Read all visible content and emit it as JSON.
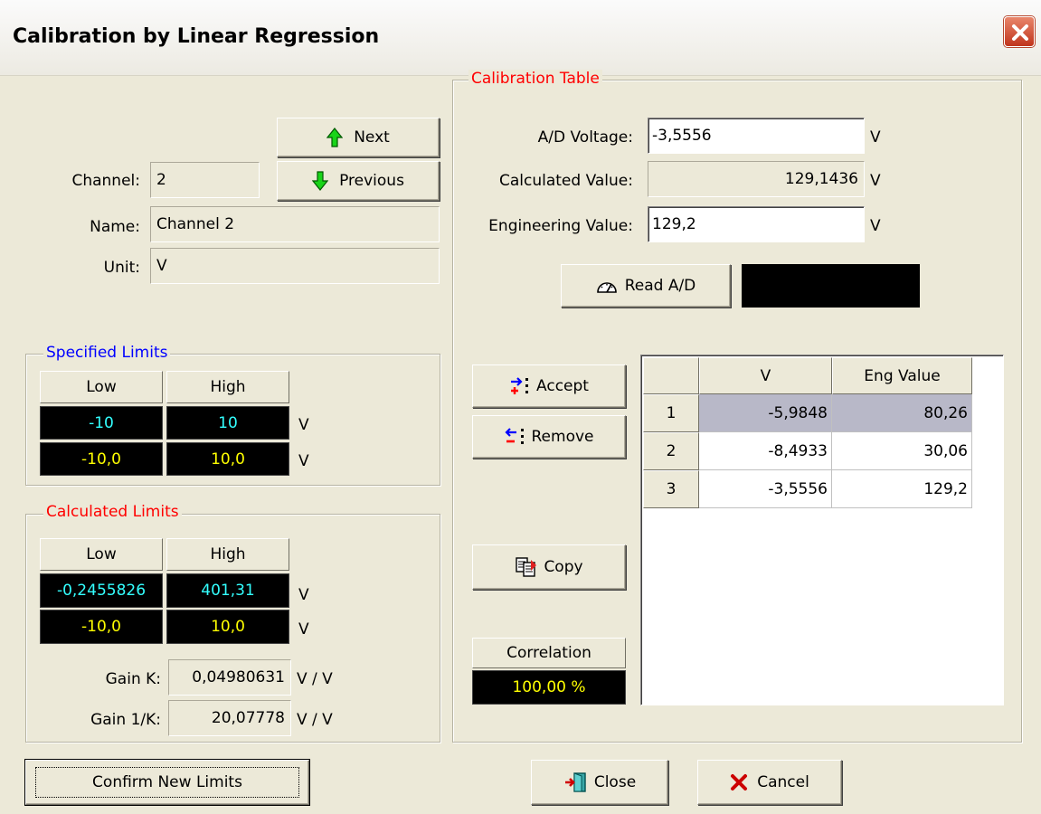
{
  "window": {
    "title": "Calibration by Linear Regression"
  },
  "channel": {
    "next_label": "Next",
    "previous_label": "Previous",
    "channel_label": "Channel:",
    "channel_value": "2",
    "name_label": "Name:",
    "name_value": "Channel 2",
    "unit_label": "Unit:",
    "unit_value": "V"
  },
  "specified_limits": {
    "title": "Specified Limits",
    "low_header": "Low",
    "high_header": "High",
    "row1": {
      "low": "-10",
      "high": "10",
      "unit": "V"
    },
    "row2": {
      "low": "-10,0",
      "high": "10,0",
      "unit": "V"
    }
  },
  "calculated_limits": {
    "title": "Calculated Limits",
    "low_header": "Low",
    "high_header": "High",
    "row1": {
      "low": "-0,2455826",
      "high": "401,31",
      "unit": "V"
    },
    "row2": {
      "low": "-10,0",
      "high": "10,0",
      "unit": "V"
    },
    "gain_k_label": "Gain K:",
    "gain_k_value": "0,04980631",
    "gain_k_unit": "V / V",
    "gain_inv_label": "Gain 1/K:",
    "gain_inv_value": "20,07778",
    "gain_inv_unit": "V / V"
  },
  "calibration_table": {
    "title": "Calibration Table",
    "ad_voltage_label": "A/D Voltage:",
    "ad_voltage_value": "-3,5556",
    "ad_voltage_unit": "V",
    "calculated_label": "Calculated Value:",
    "calculated_value": "129,1436",
    "calculated_unit": "V",
    "engineering_label": "Engineering Value:",
    "engineering_value": "129,2",
    "engineering_unit": "V",
    "read_ad_label": "Read A/D",
    "accept_label": "Accept",
    "remove_label": "Remove",
    "copy_label": "Copy",
    "correlation_label": "Correlation",
    "correlation_value": "100,00 %",
    "grid": {
      "col_v": "V",
      "col_eng": "Eng Value",
      "rows": [
        {
          "n": "1",
          "v": "-5,9848",
          "eng": "80,26"
        },
        {
          "n": "2",
          "v": "-8,4933",
          "eng": "30,06"
        },
        {
          "n": "3",
          "v": "-3,5556",
          "eng": "129,2"
        }
      ]
    }
  },
  "footer": {
    "confirm_label": "Confirm New Limits",
    "close_label": "Close",
    "cancel_label": "Cancel"
  },
  "colors": {
    "dialog_bg": "#ece9d8",
    "group_title_blue": "#0000ff",
    "group_title_red": "#ff0000",
    "lcd_cyan": "#33ffff",
    "lcd_yellow": "#ffff00",
    "selected_row": "#b8b8c8"
  }
}
